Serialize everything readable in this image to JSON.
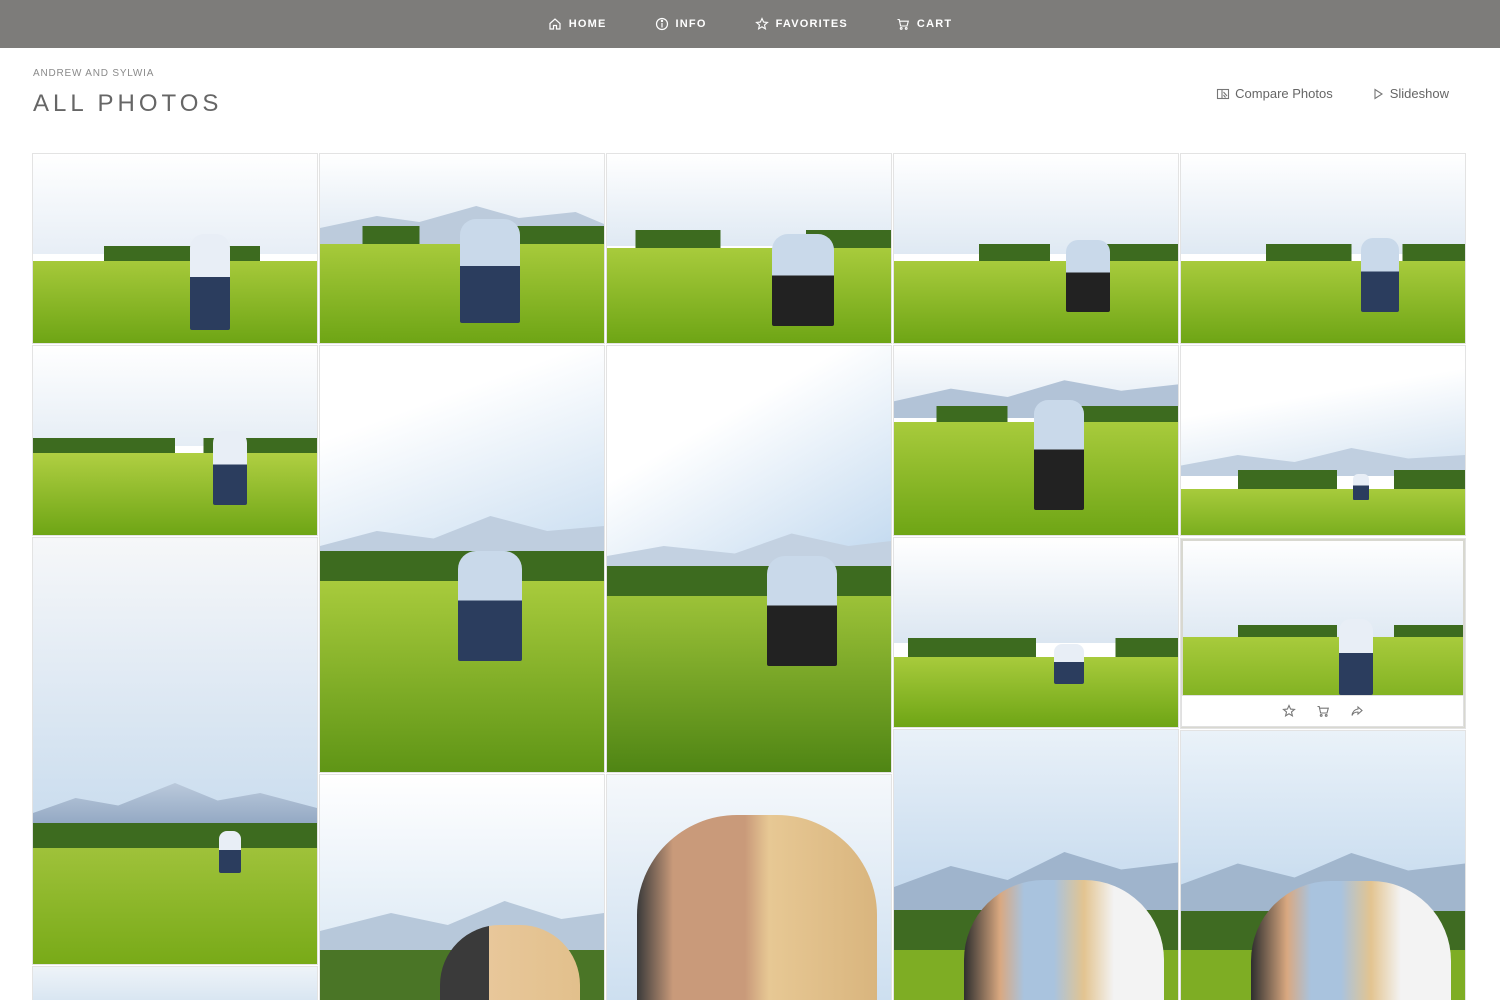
{
  "nav": {
    "items": [
      {
        "label": "HOME",
        "icon": "home-icon"
      },
      {
        "label": "INFO",
        "icon": "info-icon"
      },
      {
        "label": "FAVORITES",
        "icon": "star-icon"
      },
      {
        "label": "CART",
        "icon": "cart-icon"
      }
    ]
  },
  "header": {
    "subtitle": "ANDREW AND SYLWIA",
    "title": "ALL PHOTOS",
    "compare_label": "Compare Photos",
    "slideshow_label": "Slideshow"
  },
  "colors": {
    "nav_bg": "#7d7c7a",
    "sky": "#dfeaf6",
    "grass": "#7fb51d",
    "trees": "#3f6a1e",
    "mountains": "#a9bcd2"
  },
  "photo_actions": [
    "star-icon",
    "cart-icon",
    "share-icon"
  ]
}
